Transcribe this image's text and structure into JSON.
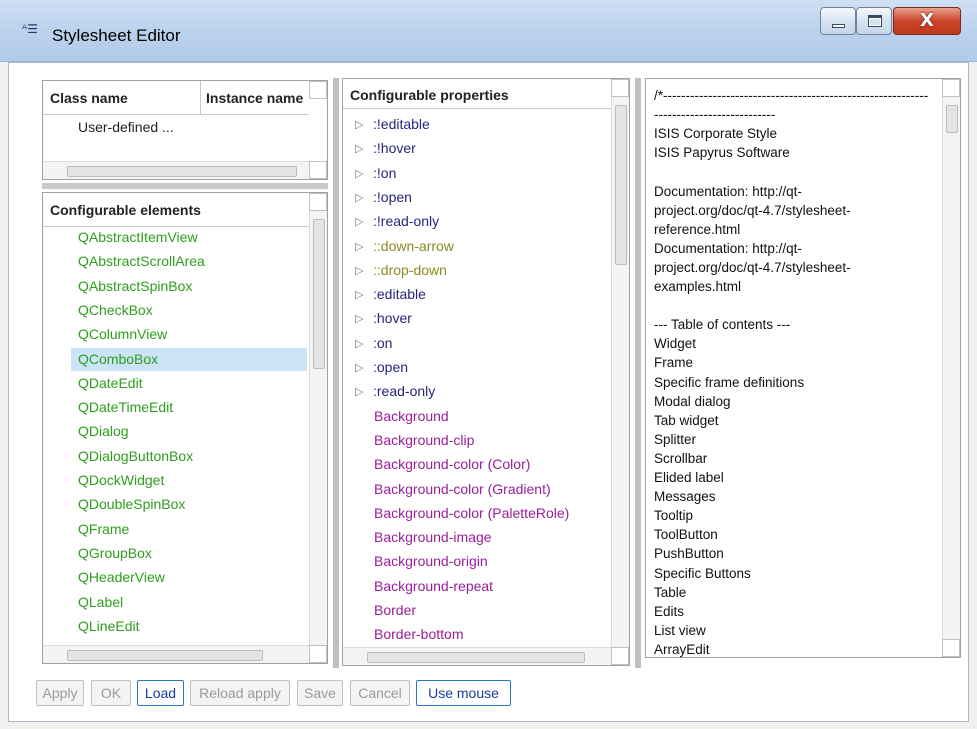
{
  "window": {
    "title": "Stylesheet Editor",
    "app_icon": "stylesheet-editor-icon",
    "title_icon_glyph": "ᴬ☰",
    "close_glyph": "X"
  },
  "class_table": {
    "col_class": "Class name",
    "col_instance": "Instance name",
    "rows": [
      "User-defined ..."
    ]
  },
  "elements": {
    "header": "Configurable elements",
    "items": [
      "QAbstractItemView",
      "QAbstractScrollArea",
      "QAbstractSpinBox",
      "QCheckBox",
      "QColumnView",
      "QComboBox",
      "QDateEdit",
      "QDateTimeEdit",
      "QDialog",
      "QDialogButtonBox",
      "QDockWidget",
      "QDoubleSpinBox",
      "QFrame",
      "QGroupBox",
      "QHeaderView",
      "QLabel",
      "QLineEdit"
    ],
    "selected": "QComboBox"
  },
  "properties": {
    "header": "Configurable properties",
    "items": [
      ":!editable",
      ":!hover",
      ":!on",
      ":!open",
      ":!read-only",
      "::down-arrow",
      "::drop-down",
      ":editable",
      ":hover",
      ":on",
      ":open",
      ":read-only",
      "Background",
      "Background-clip",
      "Background-color (Color)",
      "Background-color (Gradient)",
      "Background-color (PaletteRole)",
      "Background-image",
      "Background-origin",
      "Background-repeat",
      "Border",
      "Border-bottom"
    ]
  },
  "stylesheet_text": {
    "lines": [
      "/*-----------------------------------------------------------",
      "---------------------------",
      " ISIS Corporate Style",
      " ISIS Papyrus Software",
      "",
      "Documentation: http://qt-",
      "project.org/doc/qt-4.7/stylesheet-",
      "reference.html",
      "Documentation: http://qt-",
      "project.org/doc/qt-4.7/stylesheet-",
      "examples.html",
      "",
      "--- Table of contents ---",
      "Widget",
      "Frame",
      "Specific frame definitions",
      "Modal dialog",
      "Tab widget",
      "Splitter",
      "Scrollbar",
      "Elided label",
      "Messages",
      "Tooltip",
      "ToolButton",
      "PushButton",
      "Specific Buttons",
      "Table",
      "Edits",
      "List view",
      "ArrayEdit"
    ]
  },
  "buttons": {
    "apply": "Apply",
    "ok": "OK",
    "load": "Load",
    "reload_apply": "Reload apply",
    "save": "Save",
    "cancel": "Cancel",
    "use_mouse": "Use mouse"
  },
  "colors": {
    "element_text": "#2e9e1c",
    "pseudo_state": "#25247d",
    "sub_control": "#8b8b1c",
    "property": "#9a1e9a",
    "selection": "#cce4f7"
  }
}
